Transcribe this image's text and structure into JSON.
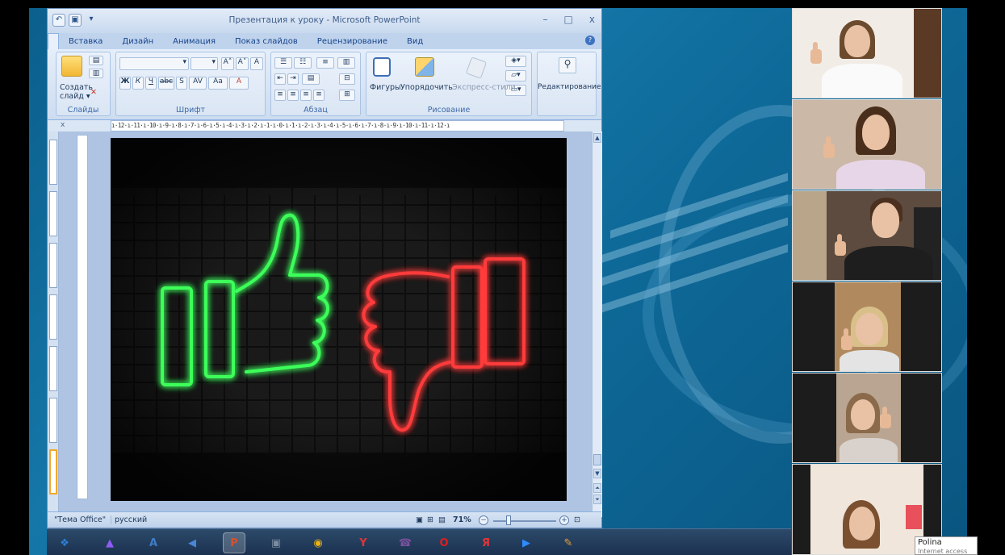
{
  "window": {
    "title": "Презентация к уроку - Microsoft PowerPoint",
    "qat": {
      "undo": "↶",
      "more": "▾"
    },
    "controls": {
      "minimize": "–",
      "maximize": "□",
      "close": "x"
    }
  },
  "ribbon": {
    "tabs": [
      "Вставка",
      "Дизайн",
      "Анимация",
      "Показ слайдов",
      "Рецензирование",
      "Вид"
    ],
    "groups": {
      "slides": {
        "label": "Слайды",
        "new_slide": "Создать",
        "new_slide2": "слайд ▾"
      },
      "font": {
        "label": "Шрифт",
        "bold": "Ж",
        "italic": "К",
        "underline": "Ч",
        "strike": "abc",
        "shadow": "S",
        "spacing": "AV",
        "case": "Aa",
        "grow": "A˄",
        "shrink": "A˅",
        "clear": "A",
        "color": "A"
      },
      "paragraph": {
        "label": "Абзац"
      },
      "drawing": {
        "label": "Рисование",
        "shapes": "Фигуры",
        "arrange": "Упорядочить",
        "quick_styles": "Экспресс-стили"
      },
      "editing": {
        "label": "Редактирование"
      }
    }
  },
  "ruler": {
    "horizontal": "ı·12·ı·11·ı·10·ı·9·ı·8·ı·7·ı·6·ı·5·ı·4·ı·3·ı·2·ı·1·ı·0·ı·1·ı·2·ı·3·ı·4·ı·5·ı·6·ı·7·ı·8·ı·9·ı·10·ı·11·ı·12·ı",
    "close": "x"
  },
  "status": {
    "theme": "\"Тема Office\"",
    "language": "русский",
    "zoom": "71%",
    "zoom_minus": "−",
    "zoom_plus": "+"
  },
  "scrollbar": {
    "up": "▲",
    "down": "▼",
    "prev": "⏶",
    "next": "⏷"
  },
  "taskbar": {
    "items": [
      {
        "icon": "windows-start-icon",
        "glyph": "❖",
        "color": "#2d7fd3"
      },
      {
        "icon": "alice-icon",
        "glyph": "▲",
        "color": "#8e5cf5"
      },
      {
        "icon": "font-app-icon",
        "glyph": "A",
        "color": "#3e7cc6"
      },
      {
        "icon": "sound-icon",
        "glyph": "◀",
        "color": "#4a86d6"
      },
      {
        "icon": "powerpoint-icon",
        "glyph": "P",
        "color": "#d35230"
      },
      {
        "icon": "scanner-icon",
        "glyph": "▣",
        "color": "#7a8aa0"
      },
      {
        "icon": "chrome-icon",
        "glyph": "◉",
        "color": "#e8b21a"
      },
      {
        "icon": "yandex-icon",
        "glyph": "Y",
        "color": "#e03636"
      },
      {
        "icon": "viber-icon",
        "glyph": "☎",
        "color": "#7b519d"
      },
      {
        "icon": "opera-icon",
        "glyph": "O",
        "color": "#e01e1e"
      },
      {
        "icon": "yandex-browser-icon",
        "glyph": "Я",
        "color": "#e03636"
      },
      {
        "icon": "zoom-icon",
        "glyph": "▶",
        "color": "#2d8cff"
      },
      {
        "icon": "paint-icon",
        "glyph": "✎",
        "color": "#e8a23a"
      }
    ]
  },
  "participants": {
    "tooltip_name": "Polina",
    "tooltip_sub": "Internet access"
  },
  "colors": {
    "ribbon_text": "#15428b",
    "neon_green": "#3cff5a",
    "neon_red": "#ff3b3b"
  }
}
